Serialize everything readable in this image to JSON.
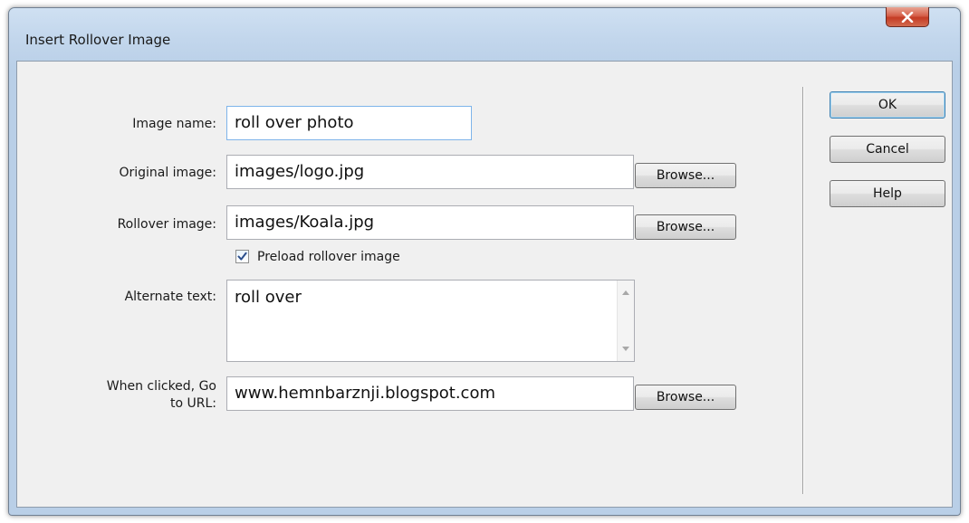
{
  "window": {
    "title": "Insert Rollover Image",
    "close_icon": "close-x-icon",
    "close_color": "#c43b24"
  },
  "form": {
    "image_name": {
      "label": "Image name:",
      "value": "roll over photo"
    },
    "original_image": {
      "label": "Original image:",
      "value": "images/logo.jpg",
      "browse_label": "Browse..."
    },
    "rollover_image": {
      "label": "Rollover image:",
      "value": "images/Koala.jpg",
      "browse_label": "Browse..."
    },
    "preload": {
      "label": "Preload rollover image",
      "checked": true
    },
    "alternate_text": {
      "label": "Alternate text:",
      "value": "roll over"
    },
    "url": {
      "label_line1": "When clicked, Go",
      "label_line2": "to URL:",
      "value": "www.hemnbarznji.blogspot.com",
      "browse_label": "Browse..."
    }
  },
  "buttons": {
    "ok_label": "OK",
    "cancel_label": "Cancel",
    "help_label": "Help"
  }
}
